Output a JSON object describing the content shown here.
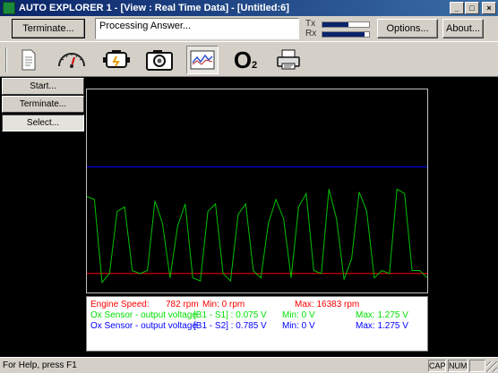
{
  "window": {
    "title": "AUTO EXPLORER 1 - [View : Real Time Data] - [Untitled:6]",
    "minimize": "_",
    "maximize": "□",
    "close": "×"
  },
  "header": {
    "terminate_label": "Terminate...",
    "status_message": "Processing Answer...",
    "tx_label": "Tx",
    "rx_label": "Rx",
    "tx_level": 0.55,
    "rx_level": 0.9,
    "options_label": "Options...",
    "about_label": "About..."
  },
  "toolbar": {
    "tools": [
      "document-icon",
      "gauge-icon",
      "engine-icon",
      "camera-icon",
      "graph-icon",
      "o2-sensor-icon",
      "printer-icon"
    ],
    "active_tool": "graph-icon",
    "o2_text": "O",
    "o2_sub": "2"
  },
  "side": {
    "start_label": "Start...",
    "terminate_label": "Terminate...",
    "select_label": "Select..."
  },
  "legend": {
    "rows": [
      {
        "name": "Engine Speed:",
        "value": "782 rpm",
        "min": "Min: 0 rpm",
        "max": "Max: 16383 rpm",
        "color": "#ff0000"
      },
      {
        "name": "Ox Sensor - output voltage",
        "value": "[B1 - S1] : 0.075 V",
        "min": "Min: 0 V",
        "max": "Max: 1.275 V",
        "color": "#00e000"
      },
      {
        "name": "Ox Sensor - output voltage",
        "value": "[B1 - S2] : 0.785 V",
        "min": "Min: 0 V",
        "max": "Max: 1.275 V",
        "color": "#0000ff"
      }
    ]
  },
  "chart_data": {
    "type": "line",
    "ylim": [
      0,
      1.275
    ],
    "grid": false,
    "series": [
      {
        "name": "Engine Speed",
        "color": "#ff0000",
        "values": [
          0.08,
          0.08,
          0.08,
          0.08,
          0.08,
          0.08,
          0.08,
          0.08,
          0.08,
          0.08,
          0.08,
          0.08,
          0.08,
          0.08,
          0.08,
          0.08,
          0.08,
          0.08,
          0.08,
          0.08,
          0.08,
          0.08,
          0.08,
          0.08,
          0.08,
          0.08,
          0.08,
          0.08,
          0.08,
          0.08,
          0.08,
          0.08,
          0.08,
          0.08,
          0.08,
          0.08,
          0.08,
          0.08,
          0.08,
          0.08,
          0.08,
          0.08,
          0.08,
          0.08,
          0.08,
          0.08
        ]
      },
      {
        "name": "Ox Sensor - output voltage [B1 - S1]",
        "color": "#00c000",
        "values": [
          0.6,
          0.58,
          0.02,
          0.08,
          0.5,
          0.53,
          0.1,
          0.08,
          0.1,
          0.57,
          0.42,
          0.05,
          0.4,
          0.55,
          0.05,
          0.03,
          0.5,
          0.55,
          0.08,
          0.03,
          0.48,
          0.55,
          0.1,
          0.05,
          0.42,
          0.58,
          0.45,
          0.05,
          0.53,
          0.62,
          0.1,
          0.08,
          0.65,
          0.45,
          0.04,
          0.18,
          0.63,
          0.5,
          0.05,
          0.1,
          0.08,
          0.65,
          0.62,
          0.1,
          0.1,
          0.05
        ]
      },
      {
        "name": "Ox Sensor - output voltage [B1 - S2]",
        "color": "#0000ff",
        "values": [
          0.8,
          0.8,
          0.8,
          0.8,
          0.8,
          0.8,
          0.8,
          0.8,
          0.8,
          0.8,
          0.8,
          0.8,
          0.8,
          0.8,
          0.8,
          0.8,
          0.8,
          0.8,
          0.8,
          0.8,
          0.8,
          0.8,
          0.8,
          0.8,
          0.8,
          0.8,
          0.8,
          0.8,
          0.8,
          0.8,
          0.8,
          0.8,
          0.8,
          0.8,
          0.8,
          0.8,
          0.8,
          0.8,
          0.8,
          0.8,
          0.8,
          0.8,
          0.8,
          0.8,
          0.8,
          0.8
        ]
      }
    ]
  },
  "statusbar": {
    "help_text": "For Help, press F1",
    "cap": "CAP",
    "num": "NUM"
  }
}
